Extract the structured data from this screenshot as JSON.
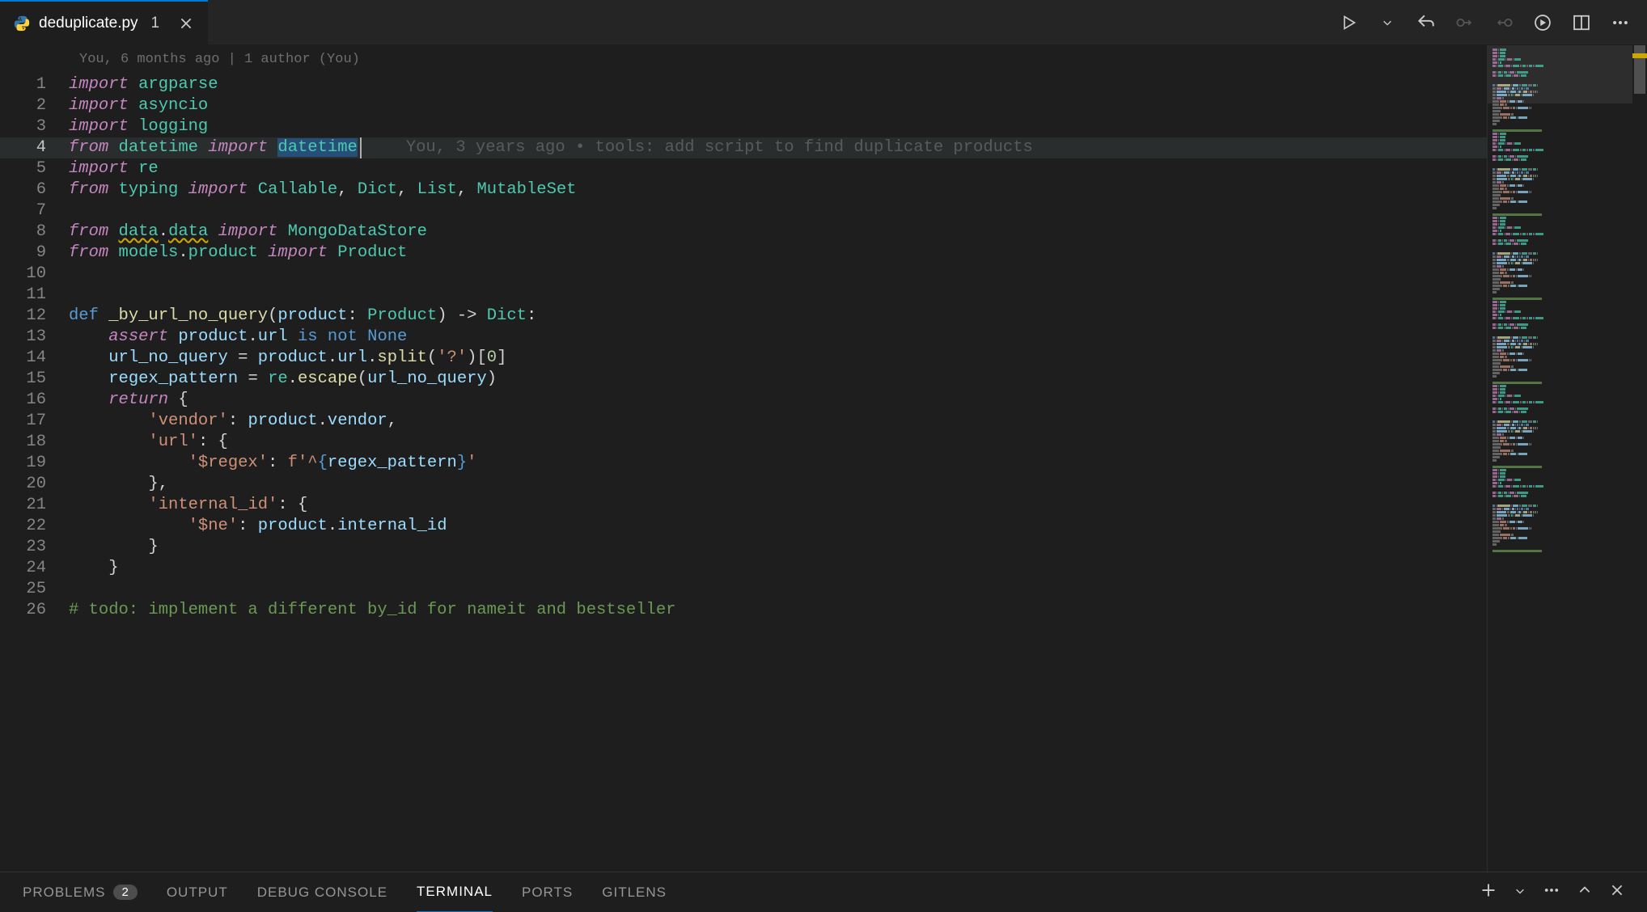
{
  "tab": {
    "filename": "deduplicate.py",
    "modified_count": "1",
    "icon": "python"
  },
  "blame_header": "You, 6 months ago | 1 author (You)",
  "blame_inline": "You, 3 years ago • tools: add script to find duplicate products",
  "active_line": 4,
  "code": [
    [
      {
        "t": "import",
        "c": "keyword"
      },
      {
        "t": " ",
        "c": "punct"
      },
      {
        "t": "argparse",
        "c": "module"
      }
    ],
    [
      {
        "t": "import",
        "c": "keyword"
      },
      {
        "t": " ",
        "c": "punct"
      },
      {
        "t": "asyncio",
        "c": "module"
      }
    ],
    [
      {
        "t": "import",
        "c": "keyword"
      },
      {
        "t": " ",
        "c": "punct"
      },
      {
        "t": "logging",
        "c": "module"
      }
    ],
    [
      {
        "t": "from",
        "c": "keyword"
      },
      {
        "t": " ",
        "c": "punct"
      },
      {
        "t": "datetime",
        "c": "module"
      },
      {
        "t": " ",
        "c": "punct"
      },
      {
        "t": "import",
        "c": "keyword"
      },
      {
        "t": " ",
        "c": "punct"
      },
      {
        "t": "datetime",
        "c": "module",
        "sel": true
      }
    ],
    [
      {
        "t": "import",
        "c": "keyword"
      },
      {
        "t": " ",
        "c": "punct"
      },
      {
        "t": "re",
        "c": "module"
      }
    ],
    [
      {
        "t": "from",
        "c": "keyword"
      },
      {
        "t": " ",
        "c": "punct"
      },
      {
        "t": "typing",
        "c": "module"
      },
      {
        "t": " ",
        "c": "punct"
      },
      {
        "t": "import",
        "c": "keyword"
      },
      {
        "t": " ",
        "c": "punct"
      },
      {
        "t": "Callable",
        "c": "type"
      },
      {
        "t": ", ",
        "c": "punct"
      },
      {
        "t": "Dict",
        "c": "type"
      },
      {
        "t": ", ",
        "c": "punct"
      },
      {
        "t": "List",
        "c": "type"
      },
      {
        "t": ", ",
        "c": "punct"
      },
      {
        "t": "MutableSet",
        "c": "type"
      }
    ],
    [],
    [
      {
        "t": "from",
        "c": "keyword"
      },
      {
        "t": " ",
        "c": "punct"
      },
      {
        "t": "data",
        "c": "module-wavy"
      },
      {
        "t": ".",
        "c": "punct"
      },
      {
        "t": "data",
        "c": "module-wavy"
      },
      {
        "t": " ",
        "c": "punct"
      },
      {
        "t": "import",
        "c": "keyword"
      },
      {
        "t": " ",
        "c": "punct"
      },
      {
        "t": "MongoDataStore",
        "c": "type"
      }
    ],
    [
      {
        "t": "from",
        "c": "keyword"
      },
      {
        "t": " ",
        "c": "punct"
      },
      {
        "t": "models",
        "c": "module"
      },
      {
        "t": ".",
        "c": "punct"
      },
      {
        "t": "product",
        "c": "module"
      },
      {
        "t": " ",
        "c": "punct"
      },
      {
        "t": "import",
        "c": "keyword"
      },
      {
        "t": " ",
        "c": "punct"
      },
      {
        "t": "Product",
        "c": "type"
      }
    ],
    [],
    [],
    [
      {
        "t": "def",
        "c": "const"
      },
      {
        "t": " ",
        "c": "punct"
      },
      {
        "t": "_by_url_no_query",
        "c": "func"
      },
      {
        "t": "(",
        "c": "punct"
      },
      {
        "t": "product",
        "c": "param"
      },
      {
        "t": ": ",
        "c": "punct"
      },
      {
        "t": "Product",
        "c": "type"
      },
      {
        "t": ") -> ",
        "c": "punct"
      },
      {
        "t": "Dict",
        "c": "type"
      },
      {
        "t": ":",
        "c": "punct"
      }
    ],
    [
      {
        "t": "    ",
        "c": "punct"
      },
      {
        "t": "assert",
        "c": "keyword"
      },
      {
        "t": " ",
        "c": "punct"
      },
      {
        "t": "product",
        "c": "var"
      },
      {
        "t": ".",
        "c": "punct"
      },
      {
        "t": "url",
        "c": "var"
      },
      {
        "t": " ",
        "c": "punct"
      },
      {
        "t": "is",
        "c": "const"
      },
      {
        "t": " ",
        "c": "punct"
      },
      {
        "t": "not",
        "c": "const"
      },
      {
        "t": " ",
        "c": "punct"
      },
      {
        "t": "None",
        "c": "const"
      }
    ],
    [
      {
        "t": "    ",
        "c": "punct"
      },
      {
        "t": "url_no_query",
        "c": "var"
      },
      {
        "t": " = ",
        "c": "op"
      },
      {
        "t": "product",
        "c": "var"
      },
      {
        "t": ".",
        "c": "punct"
      },
      {
        "t": "url",
        "c": "var"
      },
      {
        "t": ".",
        "c": "punct"
      },
      {
        "t": "split",
        "c": "func"
      },
      {
        "t": "(",
        "c": "punct"
      },
      {
        "t": "'?'",
        "c": "string"
      },
      {
        "t": ")[",
        "c": "punct"
      },
      {
        "t": "0",
        "c": "num"
      },
      {
        "t": "]",
        "c": "punct"
      }
    ],
    [
      {
        "t": "    ",
        "c": "punct"
      },
      {
        "t": "regex_pattern",
        "c": "var"
      },
      {
        "t": " = ",
        "c": "op"
      },
      {
        "t": "re",
        "c": "module"
      },
      {
        "t": ".",
        "c": "punct"
      },
      {
        "t": "escape",
        "c": "func"
      },
      {
        "t": "(",
        "c": "punct"
      },
      {
        "t": "url_no_query",
        "c": "var"
      },
      {
        "t": ")",
        "c": "punct"
      }
    ],
    [
      {
        "t": "    ",
        "c": "punct"
      },
      {
        "t": "return",
        "c": "keyword"
      },
      {
        "t": " {",
        "c": "punct"
      }
    ],
    [
      {
        "t": "        ",
        "c": "punct"
      },
      {
        "t": "'vendor'",
        "c": "string"
      },
      {
        "t": ": ",
        "c": "punct"
      },
      {
        "t": "product",
        "c": "var"
      },
      {
        "t": ".",
        "c": "punct"
      },
      {
        "t": "vendor",
        "c": "var"
      },
      {
        "t": ",",
        "c": "punct"
      }
    ],
    [
      {
        "t": "        ",
        "c": "punct"
      },
      {
        "t": "'url'",
        "c": "string"
      },
      {
        "t": ": {",
        "c": "punct"
      }
    ],
    [
      {
        "t": "            ",
        "c": "punct"
      },
      {
        "t": "'$regex'",
        "c": "string"
      },
      {
        "t": ": ",
        "c": "punct"
      },
      {
        "t": "f'^",
        "c": "string"
      },
      {
        "t": "{",
        "c": "const"
      },
      {
        "t": "regex_pattern",
        "c": "var"
      },
      {
        "t": "}",
        "c": "const"
      },
      {
        "t": "'",
        "c": "string"
      }
    ],
    [
      {
        "t": "        },",
        "c": "punct"
      }
    ],
    [
      {
        "t": "        ",
        "c": "punct"
      },
      {
        "t": "'internal_id'",
        "c": "string"
      },
      {
        "t": ": {",
        "c": "punct"
      }
    ],
    [
      {
        "t": "            ",
        "c": "punct"
      },
      {
        "t": "'$ne'",
        "c": "string"
      },
      {
        "t": ": ",
        "c": "punct"
      },
      {
        "t": "product",
        "c": "var"
      },
      {
        "t": ".",
        "c": "punct"
      },
      {
        "t": "internal_id",
        "c": "var"
      }
    ],
    [
      {
        "t": "        }",
        "c": "punct"
      }
    ],
    [
      {
        "t": "    }",
        "c": "punct"
      }
    ],
    [],
    [
      {
        "t": "# todo: implement a different by_id for nameit and bestseller",
        "c": "comment"
      }
    ]
  ],
  "panel": {
    "tabs": [
      "PROBLEMS",
      "OUTPUT",
      "DEBUG CONSOLE",
      "TERMINAL",
      "PORTS",
      "GITLENS"
    ],
    "problems_count": "2",
    "active": "TERMINAL"
  }
}
